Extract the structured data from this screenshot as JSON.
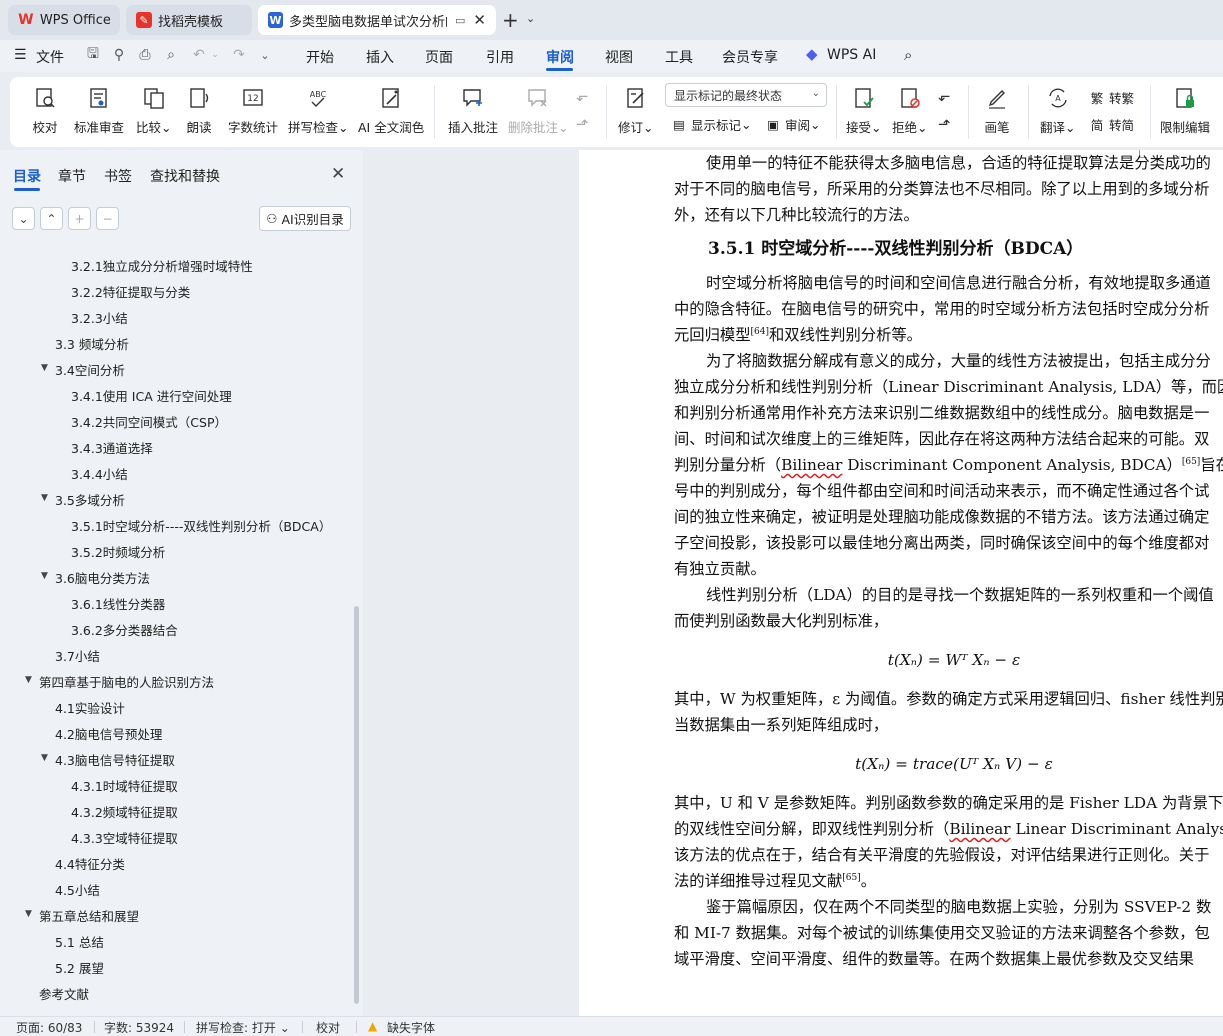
{
  "tabs": [
    {
      "label": "WPS Office",
      "icon": "wps-logo"
    },
    {
      "label": "找稻壳模板",
      "icon": "docer-logo"
    },
    {
      "label": "多类型脑电数据单试次分析的",
      "icon": "writer-logo"
    }
  ],
  "menu": {
    "file": "文件",
    "items": [
      "开始",
      "插入",
      "页面",
      "引用",
      "审阅",
      "视图",
      "工具",
      "会员专享"
    ],
    "active": "审阅",
    "wps_ai": "WPS AI"
  },
  "ribbon": {
    "proofread": "校对",
    "standard_review": "标准审查",
    "compare": "比较",
    "read_aloud": "朗读",
    "word_count": "字数统计",
    "spell_check": "拼写检查",
    "ai_polish": "AI 全文润色",
    "insert_comment": "插入批注",
    "delete_comment": "删除批注",
    "track_changes": "修订",
    "markup_mode": "显示标记的最终状态",
    "show_markup": "显示标记",
    "review_pane": "审阅",
    "accept": "接受",
    "reject": "拒绝",
    "ink": "画笔",
    "translate": "翻译",
    "to_traditional": "转繁",
    "to_simplified": "转简",
    "restrict_editing": "限制编辑"
  },
  "nav": {
    "tabs": [
      "目录",
      "章节",
      "书签",
      "查找和替换"
    ],
    "active_tab": "目录",
    "ai_toc_button": "AI识别目录",
    "toc": [
      {
        "text": "3.2.1独立成分分析增强时域特性",
        "level": 3
      },
      {
        "text": "3.2.2特征提取与分类",
        "level": 3
      },
      {
        "text": "3.2.3小结",
        "level": 3
      },
      {
        "text": "3.3 频域分析",
        "level": 2
      },
      {
        "text": "3.4空间分析",
        "level": 2,
        "expanded": true
      },
      {
        "text": "3.4.1使用 ICA 进行空间处理",
        "level": 3
      },
      {
        "text": "3.4.2共同空间模式（CSP）",
        "level": 3
      },
      {
        "text": "3.4.3通道选择",
        "level": 3
      },
      {
        "text": "3.4.4小结",
        "level": 3
      },
      {
        "text": "3.5多域分析",
        "level": 2,
        "expanded": true
      },
      {
        "text": "3.5.1时空域分析----双线性判别分析（BDCA）",
        "level": 3
      },
      {
        "text": "3.5.2时频域分析",
        "level": 3
      },
      {
        "text": "3.6脑电分类方法",
        "level": 2,
        "expanded": true
      },
      {
        "text": "3.6.1线性分类器",
        "level": 3
      },
      {
        "text": "3.6.2多分类器结合",
        "level": 3
      },
      {
        "text": "3.7小结",
        "level": 2
      },
      {
        "text": "第四章基于脑电的人脸识别方法",
        "level": 1,
        "expanded": true
      },
      {
        "text": "4.1实验设计",
        "level": 2
      },
      {
        "text": "4.2脑电信号预处理",
        "level": 2
      },
      {
        "text": "4.3脑电信号特征提取",
        "level": 2,
        "expanded": true
      },
      {
        "text": "4.3.1时域特征提取",
        "level": 3
      },
      {
        "text": "4.3.2频域特征提取",
        "level": 3
      },
      {
        "text": "4.3.3空域特征提取",
        "level": 3
      },
      {
        "text": "4.4特征分类",
        "level": 2
      },
      {
        "text": "4.5小结",
        "level": 2
      },
      {
        "text": "第五章总结和展望",
        "level": 1,
        "expanded": true
      },
      {
        "text": "5.1 总结",
        "level": 2
      },
      {
        "text": "5.2 展望",
        "level": 2
      },
      {
        "text": "参考文献",
        "level": 1
      }
    ]
  },
  "doc": {
    "p1": [
      "使用单一的特征不能获得太多脑电信息，合适的特征提取算法是分类成功的",
      "对于不同的脑电信号，所采用的分类算法也不尽相同。除了以上用到的多域分析",
      "外，还有以下几种比较流行的方法。"
    ],
    "heading": "3.5.1  时空域分析----双线性判别分析（BDCA）",
    "p2": [
      "时空域分析将脑电信号的时间和空间信息进行融合分析，有效地提取多通道",
      "中的隐含特征。在脑电信号的研究中，常用的时空域分析方法包括时空成分分析",
      "元回归模型",
      "[64]",
      "和双线性判别分析等。"
    ],
    "p3_1": "为了将脑数据分解成有意义的成分，大量的线性方法被提出，包括主成分分",
    "p3_2": "独立成分分析和线性判别分析（Linear Discriminant Analysis, LDA）等，而因子",
    "p3_3": "和判别分析通常用作补充方法来识别二维数据数组中的线性成分。脑电数据是一",
    "p3_4": "间、时间和试次维度上的三维矩阵，因此存在将这两种方法结合起来的可能。双",
    "p3_5a": "判别分量分析（",
    "p3_5b": "Bilinear",
    "p3_5c": " Discriminant Component Analysis, BDCA）",
    "p3_5d": "[65]",
    "p3_5e": "旨在识别脑",
    "p3_6": "号中的判别成分，每个组件都由空间和时间活动来表示，而不确定性通过各个试",
    "p3_7": "间的独立性来确定，被证明是处理脑功能成像数据的不错方法。该方法通过确定",
    "p3_8": "子空间投影，该投影可以最佳地分离出两类，同时确保该空间中的每个维度都对",
    "p3_9": "有独立贡献。",
    "p4_1": "线性判别分析（LDA）的目的是寻找一个数据矩阵的一系列权重和一个阈值",
    "p4_2": "而使判别函数最大化判别标准，",
    "formula1": "t(Xₙ) = Wᵀ Xₙ − ε",
    "p5_1": "其中，W 为权重矩阵，ε 为阈值。参数的确定方式采用逻辑回归、fisher 线性判别",
    "p5_2": "当数据集由一系列矩阵组成时，",
    "formula2": "t(Xₙ) = trace(Uᵀ Xₙ V) − ε",
    "p6_1": "其中，U 和 V 是参数矩阵。判别函数参数的确定采用的是 Fisher LDA 为背景下",
    "p6_2a": "的双线性空间分解，即双线性判别分析（",
    "p6_2b": "Bilinear",
    "p6_2c": " Linear Discriminant Analysis, BL",
    "p6_3": "该方法的优点在于，结合有关平滑度的先验假设，对评估结果进行正则化。关于",
    "p6_4a": "法的详细推导过程见文献",
    "p6_4b": "[65]",
    "p6_4c": "。",
    "p7_1": "鉴于篇幅原因，仅在两个不同类型的脑电数据上实验，分别为 SSVEP-2 数",
    "p7_2": "和 MI-7 数据集。对每个被试的训练集使用交叉验证的方法来调整各个参数，包",
    "p7_3": "域平滑度、空间平滑度、组件的数量等。在两个数据集上最优参数及交叉结果"
  },
  "status": {
    "page": "页面: 60/83",
    "words": "字数: 53924",
    "spell": "拼写检查: 打开",
    "proof": "校对",
    "missing_font": "缺失字体"
  },
  "colors": {
    "accent": "#1a5ed1",
    "wps_red": "#e8332a",
    "writer_blue": "#2b64d9",
    "warning": "#f0a800"
  }
}
